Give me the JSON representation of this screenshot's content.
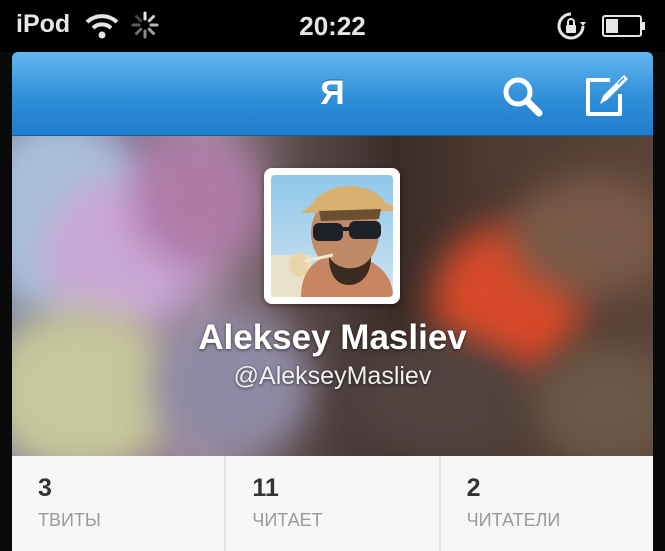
{
  "status_bar": {
    "carrier": "iPod",
    "time": "20:22"
  },
  "nav": {
    "title": "Я",
    "search_icon": "search-icon",
    "compose_icon": "compose-icon"
  },
  "profile": {
    "name": "Aleksey Masliev",
    "handle": "@AlekseyMasliev"
  },
  "stats": [
    {
      "count": "3",
      "label": "ТВИТЫ"
    },
    {
      "count": "11",
      "label": "ЧИТАЕТ"
    },
    {
      "count": "2",
      "label": "ЧИТАТЕЛИ"
    }
  ],
  "colors": {
    "nav_blue": "#2f8fd8",
    "stat_label": "#9a9a9a"
  }
}
